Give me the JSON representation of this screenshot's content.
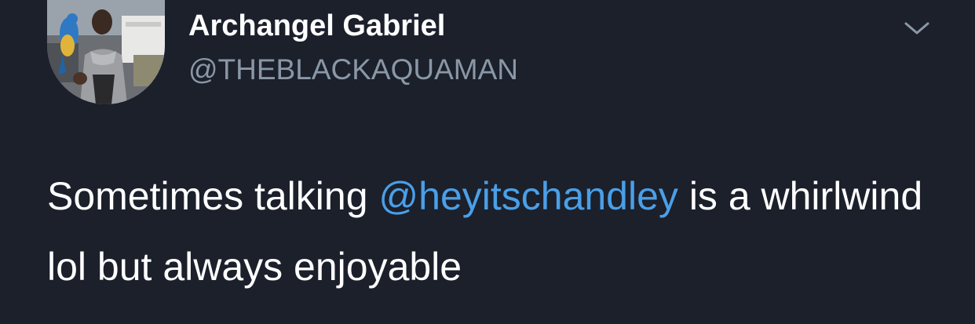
{
  "author": {
    "name": "Archangel Gabriel",
    "handle": "@THEBLACKAQUAMAN"
  },
  "tweet": {
    "text_before": "Sometimes talking ",
    "mention": "@heyitschandley",
    "text_after": " is a whirlwind lol but always enjoyable"
  },
  "colors": {
    "background": "#1b202b",
    "name": "#ffffff",
    "handle": "#8a97a6",
    "mention": "#4a9fe8",
    "body": "#ffffff"
  },
  "icons": {
    "menu": "chevron-down-icon"
  }
}
